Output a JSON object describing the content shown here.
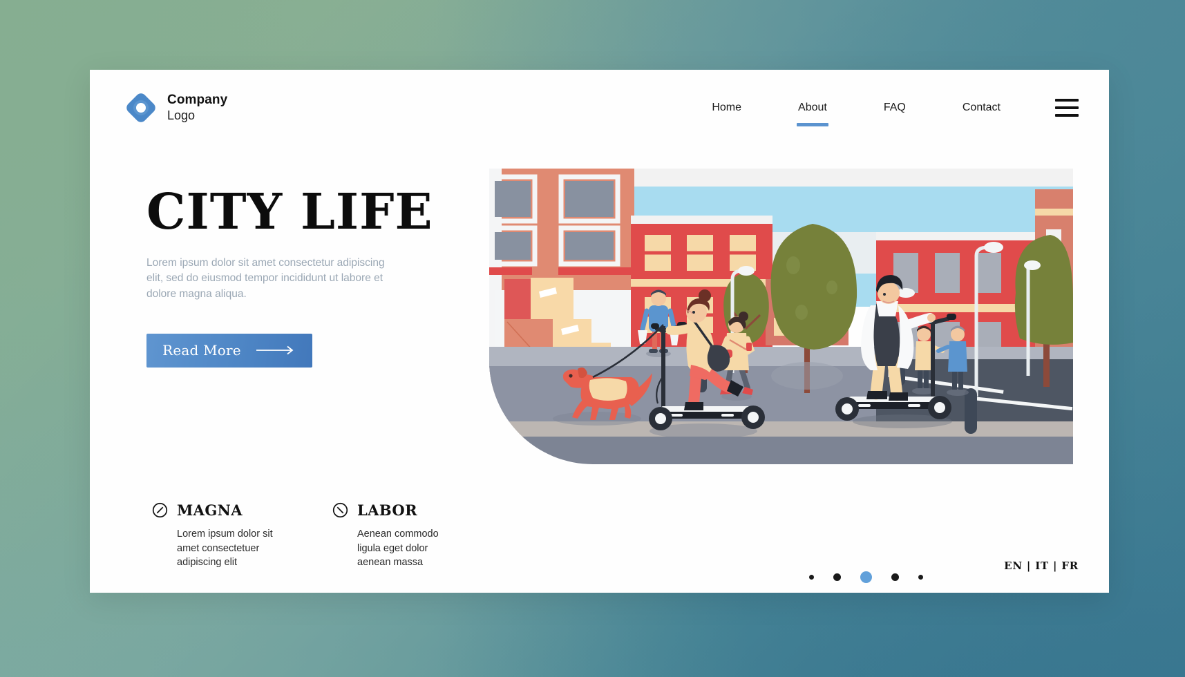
{
  "brand": {
    "line1": "Company",
    "line2": "Logo",
    "logo_icon": "diamond-ring-logo-icon",
    "accent_color": "#4b88c8"
  },
  "nav": {
    "items": [
      {
        "label": "Home",
        "active": false
      },
      {
        "label": "About",
        "active": true
      },
      {
        "label": "FAQ",
        "active": false
      },
      {
        "label": "Contact",
        "active": false
      }
    ],
    "menu_icon": "hamburger-menu-icon",
    "active_underline_color": "#5b93cf"
  },
  "hero": {
    "headline": "CITY LIFE",
    "subcopy": "Lorem ipsum dolor sit amet consectetur adipiscing elit, sed do eiusmod tempor incididunt ut labore et dolore magna aliqua.",
    "cta_label": "Read More",
    "cta_icon": "long-right-arrow-icon",
    "cta_color": "#4f87c6",
    "subcopy_color": "#9aa7b4"
  },
  "features": [
    {
      "icon": "circle-slash-up-icon",
      "title": "MAGNA",
      "body": "Lorem ipsum dolor sit amet consectetuer adipiscing elit"
    },
    {
      "icon": "circle-slash-down-icon",
      "title": "LABOR",
      "body": "Aenean commodo ligula eget dolor aenean massa"
    }
  ],
  "illustration": {
    "alt": "city-street-scooter-illustration",
    "palette": {
      "sky": "#a8dcf0",
      "building_red": "#e04b4b",
      "building_salmon": "#e08a72",
      "window_cream": "#f6d9a8",
      "tree_green": "#76813a",
      "road_gray": "#8d93a3",
      "sidewalk": "#b0b5c0",
      "asphalt": "#4e5663",
      "skin": "#f3c8a0",
      "coral": "#f4786b"
    }
  },
  "carousel": {
    "dots": [
      {
        "size": "xs",
        "active": false
      },
      {
        "size": "sm",
        "active": false
      },
      {
        "size": "lg",
        "active": true
      },
      {
        "size": "sm",
        "active": false
      },
      {
        "size": "xs",
        "active": false
      }
    ],
    "active_color": "#61a0da"
  },
  "language": {
    "label": "EN | IT | FR",
    "options": [
      "EN",
      "IT",
      "FR"
    ],
    "selected": "EN"
  },
  "background": {
    "gradient_from": "#86ae91",
    "gradient_to": "#36748f"
  }
}
